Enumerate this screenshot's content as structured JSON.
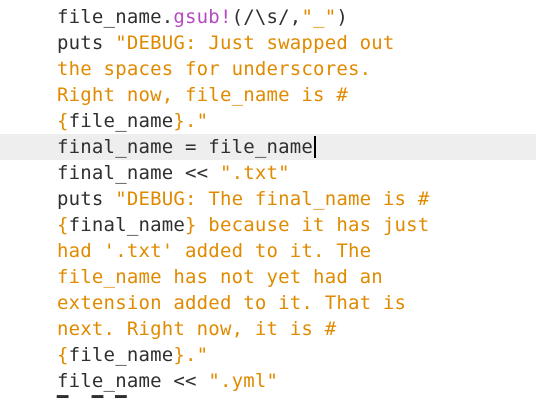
{
  "editor": {
    "lines": [
      [
        {
          "t": "file_name.",
          "c": "plain"
        },
        {
          "t": "gsub!",
          "c": "fn"
        },
        {
          "t": "(/\\s/,",
          "c": "plain"
        },
        {
          "t": "\"_\"",
          "c": "str"
        },
        {
          "t": ")",
          "c": "plain"
        }
      ],
      [
        {
          "t": "puts ",
          "c": "plain"
        },
        {
          "t": "\"DEBUG: Just swapped out",
          "c": "str"
        }
      ],
      [
        {
          "t": "the spaces for underscores.",
          "c": "str"
        }
      ],
      [
        {
          "t": "Right now, file_name is #",
          "c": "str"
        }
      ],
      [
        {
          "t": "{",
          "c": "str"
        },
        {
          "t": "file_name",
          "c": "plain"
        },
        {
          "t": "}.\"",
          "c": "str"
        }
      ],
      [
        {
          "t": "final_name = file_name",
          "c": "plain"
        }
      ],
      [
        {
          "t": "final_name << ",
          "c": "plain"
        },
        {
          "t": "\".txt\"",
          "c": "str"
        }
      ],
      [
        {
          "t": "puts ",
          "c": "plain"
        },
        {
          "t": "\"DEBUG: The final_name is #",
          "c": "str"
        }
      ],
      [
        {
          "t": "{",
          "c": "str"
        },
        {
          "t": "final_name",
          "c": "plain"
        },
        {
          "t": "} because it has just",
          "c": "str"
        }
      ],
      [
        {
          "t": "had '.txt' added to it. The",
          "c": "str"
        }
      ],
      [
        {
          "t": "file_name has not yet had an",
          "c": "str"
        }
      ],
      [
        {
          "t": "extension added to it. That is",
          "c": "str"
        }
      ],
      [
        {
          "t": "next. Right now, it is #",
          "c": "str"
        }
      ],
      [
        {
          "t": "{",
          "c": "str"
        },
        {
          "t": "file_name",
          "c": "plain"
        },
        {
          "t": "}.\"",
          "c": "str"
        }
      ],
      [
        {
          "t": "file_name << ",
          "c": "plain"
        },
        {
          "t": "\".yml\"",
          "c": "str"
        }
      ]
    ],
    "current_line": 5
  },
  "colors": {
    "string": "#e08a00",
    "method": "#b44ac0",
    "text": "#2f2f2f",
    "current_line_bg": "#eeeeee"
  }
}
